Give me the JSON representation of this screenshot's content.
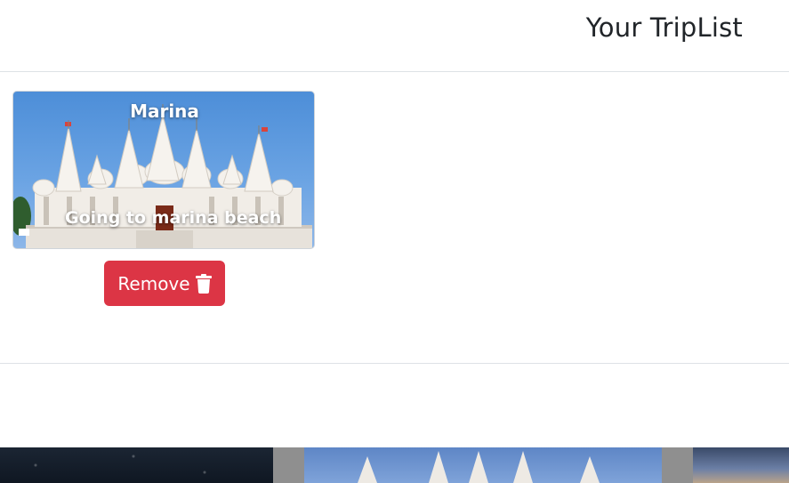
{
  "modal": {
    "title": "Your TripList"
  },
  "trips": [
    {
      "name": "Marina",
      "description": "Going to marina beach",
      "image_icon": "temple-photo",
      "remove_label": "Remove",
      "remove_icon": "trash-icon"
    }
  ],
  "colors": {
    "danger": "#dc3545",
    "title_text": "#212529",
    "divider": "#dee2e6"
  }
}
